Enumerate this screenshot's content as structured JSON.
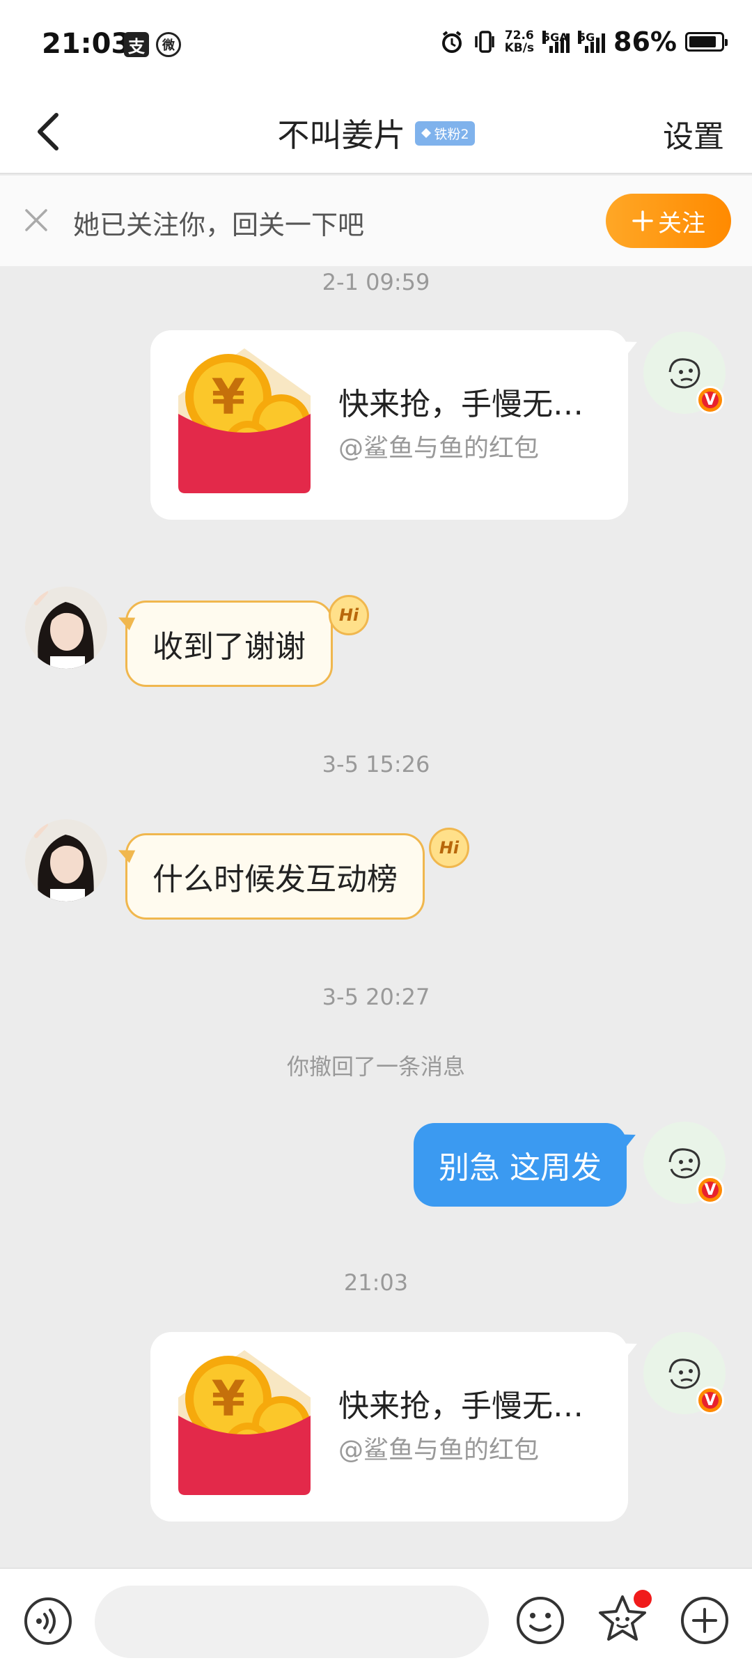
{
  "status_bar": {
    "time": "21:03",
    "app_icon_1": "支",
    "app_icon_2": "微",
    "net_speed_value": "72.6",
    "net_speed_unit": "KB/s",
    "sim1_label": "5GA",
    "sim2_label": "5G",
    "battery_text": "86%",
    "battery_level": 0.86
  },
  "header": {
    "title": "不叫姜片",
    "fan_badge": "铁粉2",
    "settings_label": "设置"
  },
  "follow_bar": {
    "text": "她已关注你，回关一下吧",
    "button_label": "关注"
  },
  "messages": {
    "ts_1": "2-1 09:59",
    "rp_1": {
      "title": "快来抢，手慢无…",
      "subtitle": "@鲨鱼与鱼的红包"
    },
    "her_1": "收到了谢谢",
    "hi_label": "Hi",
    "ts_2": "3-5 15:26",
    "her_2": "什么时候发互动榜",
    "ts_3": "3-5 20:27",
    "recall_notice": "你撤回了一条消息",
    "me_1": "别急 这周发",
    "ts_4": "21:03",
    "rp_2": {
      "title": "快来抢，手慢无…",
      "subtitle": "@鲨鱼与鱼的红包"
    },
    "vip_mark": "V"
  },
  "colors": {
    "accent_orange": "#ff8a00",
    "my_bubble": "#3b9af1",
    "her_bubble_border": "#f0b74e",
    "red_packet": "#e3294a"
  }
}
